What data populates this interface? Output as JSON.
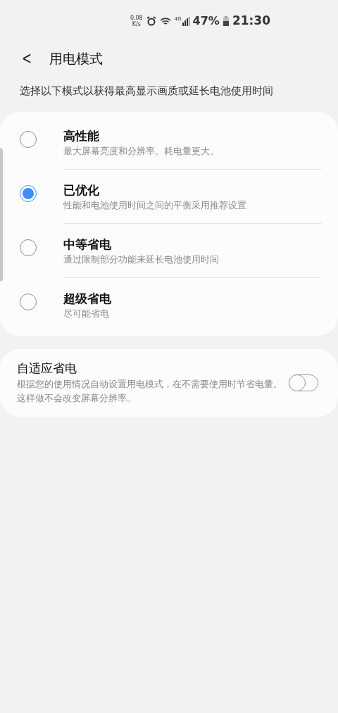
{
  "status_bar": {
    "net_speed": "0.08",
    "net_unit": "K/s",
    "network": "4G",
    "battery": "47%",
    "time": "21:30"
  },
  "header": {
    "back": "<",
    "title": "用电模式"
  },
  "subtitle": "选择以下模式以获得最高显示画质或延长电池使用时间",
  "modes": [
    {
      "title": "高性能",
      "description": "最大屏幕亮度和分辨率。耗电量更大。",
      "selected": false
    },
    {
      "title": "已优化",
      "description": "性能和电池使用时间之间的平衡采用推荐设置",
      "selected": true
    },
    {
      "title": "中等省电",
      "description": "通过限制部分功能来延长电池使用时间",
      "selected": false
    },
    {
      "title": "超级省电",
      "description": "尽可能省电",
      "selected": false
    }
  ],
  "adaptive": {
    "title": "自适应省电",
    "description": "根据您的使用情况自动设置用电模式，在不需要使用时节省电量。这样做不会改变屏幕分辨率。",
    "on": false
  }
}
